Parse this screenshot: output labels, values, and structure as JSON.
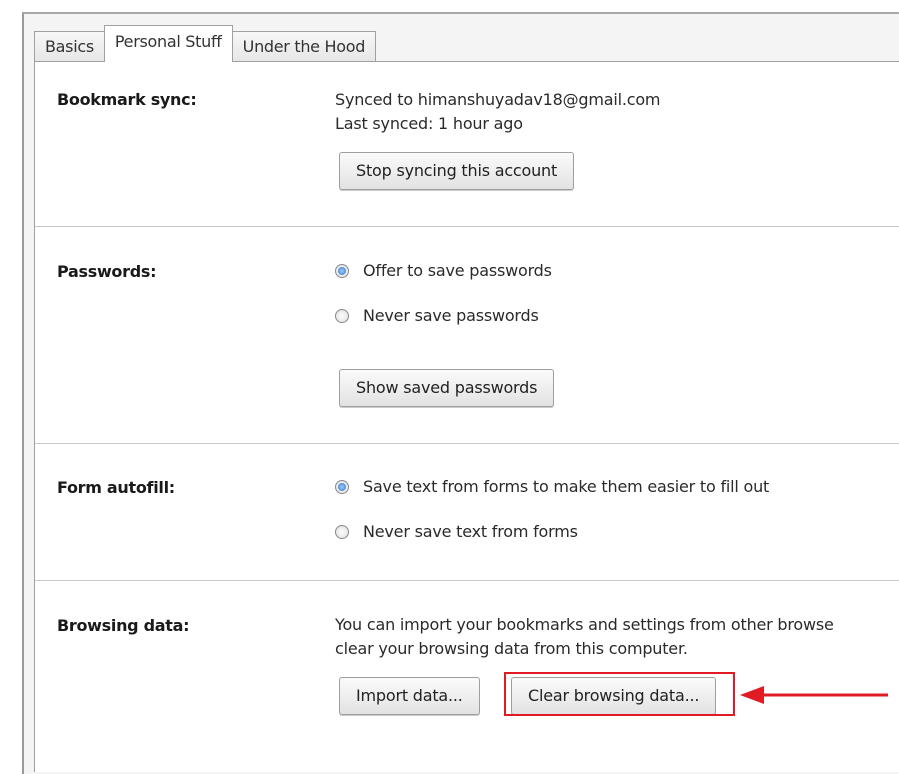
{
  "tabs": [
    {
      "label": "Basics",
      "active": false
    },
    {
      "label": "Personal Stuff",
      "active": true
    },
    {
      "label": "Under the Hood",
      "active": false
    }
  ],
  "bookmark_sync": {
    "label": "Bookmark sync:",
    "synced_to": "Synced to himanshuyadav18@gmail.com",
    "last_synced": "Last synced: 1 hour ago",
    "button": "Stop syncing this account"
  },
  "passwords": {
    "label": "Passwords:",
    "options": [
      {
        "label": "Offer to save passwords",
        "checked": true
      },
      {
        "label": "Never save passwords",
        "checked": false
      }
    ],
    "button": "Show saved passwords"
  },
  "form_autofill": {
    "label": "Form autofill:",
    "options": [
      {
        "label": "Save text from forms to make them easier to fill out",
        "checked": true
      },
      {
        "label": "Never save text from forms",
        "checked": false
      }
    ]
  },
  "browsing_data": {
    "label": "Browsing data:",
    "description_line1": "You can import your bookmarks and settings from other browse",
    "description_line2": "clear your browsing data from this computer.",
    "import_button": "Import data...",
    "clear_button": "Clear browsing data..."
  },
  "colors": {
    "highlight": "#e01b24",
    "radio_checked": "#2b6fc4"
  }
}
